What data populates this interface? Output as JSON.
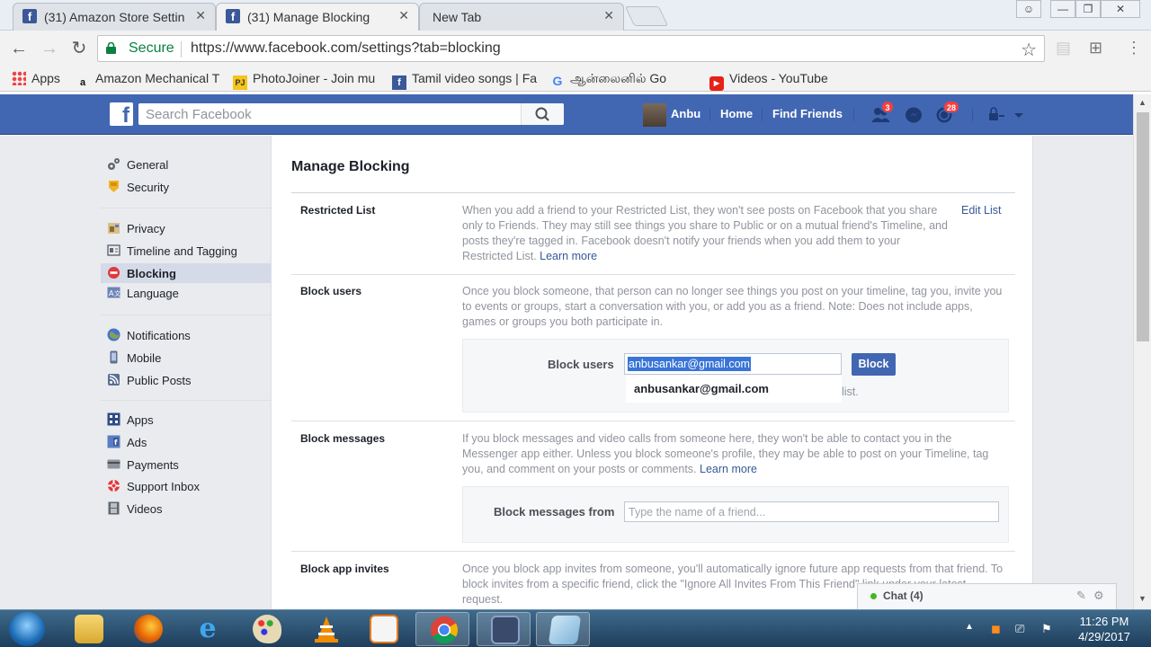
{
  "browser": {
    "tabs": [
      {
        "title": "(31) Amazon Store Settin"
      },
      {
        "title": "(31) Manage Blocking"
      },
      {
        "title": "New Tab"
      }
    ],
    "secure_label": "Secure",
    "url": "https://www.facebook.com/settings?tab=blocking",
    "bookmarks": [
      {
        "label": "Apps",
        "icon": "apps-grid-icon"
      },
      {
        "label": "Amazon Mechanical T",
        "icon": "amazon-icon"
      },
      {
        "label": "PhotoJoiner - Join mu",
        "icon": "photojoiner-icon"
      },
      {
        "label": "Tamil video songs | Fa",
        "icon": "facebook-icon"
      },
      {
        "label": "ஆன்லைனில் Go",
        "icon": "google-icon"
      },
      {
        "label": "Videos - YouTube",
        "icon": "youtube-icon"
      }
    ]
  },
  "fb": {
    "search_placeholder": "Search Facebook",
    "user_name": "Anbu",
    "home": "Home",
    "find_friends": "Find Friends",
    "friend_requests_count": "3",
    "notifications_count": "28",
    "brand_color": "#4267b2"
  },
  "sidebar": {
    "items": [
      {
        "label": "General",
        "icon": "gear-icon"
      },
      {
        "label": "Security",
        "icon": "badge-icon"
      },
      {
        "label": "Privacy",
        "icon": "lock-icon"
      },
      {
        "label": "Timeline and Tagging",
        "icon": "timeline-icon"
      },
      {
        "label": "Blocking",
        "icon": "block-icon"
      },
      {
        "label": "Language",
        "icon": "language-icon"
      },
      {
        "label": "Notifications",
        "icon": "globe-icon"
      },
      {
        "label": "Mobile",
        "icon": "mobile-icon"
      },
      {
        "label": "Public Posts",
        "icon": "rss-icon"
      },
      {
        "label": "Apps",
        "icon": "apps-icon"
      },
      {
        "label": "Ads",
        "icon": "ads-icon"
      },
      {
        "label": "Payments",
        "icon": "card-icon"
      },
      {
        "label": "Support Inbox",
        "icon": "lifebuoy-icon"
      },
      {
        "label": "Videos",
        "icon": "film-icon"
      }
    ]
  },
  "main": {
    "title": "Manage Blocking",
    "restricted": {
      "label": "Restricted List",
      "text": "When you add a friend to your Restricted List, they won't see posts on Facebook that you share only to Friends. They may still see things you share to Public or on a mutual friend's Timeline, and posts they're tagged in. Facebook doesn't notify your friends when you add them to your Restricted List.",
      "learn_more": "Learn more",
      "edit_link": "Edit List"
    },
    "block_users": {
      "label": "Block users",
      "text": "Once you block someone, that person can no longer see things you post on your timeline, tag you, invite you to events or groups, start a conversation with you, or add you as a friend. Note: Does not include apps, games or groups you both participate in.",
      "field_label": "Block users",
      "input_value": "anbusankar@gmail.com",
      "button": "Block",
      "suggestion": "anbusankar@gmail.com",
      "partial_text": "list."
    },
    "block_messages": {
      "label": "Block messages",
      "text": "If you block messages and video calls from someone here, they won't be able to contact you in the Messenger app either. Unless you block someone's profile, they may be able to post on your Timeline, tag you, and comment on your posts or comments.",
      "learn_more": "Learn more",
      "field_label": "Block messages from",
      "placeholder": "Type the name of a friend..."
    },
    "block_app_invites": {
      "label": "Block app invites",
      "text": "Once you block app invites from someone, you'll automatically ignore future app requests from that friend. To block invites from a specific friend, click the \"Ignore All Invites From This Friend\" link under your latest request."
    }
  },
  "chat": {
    "label": "Chat (4)"
  },
  "taskbar": {
    "time": "11:26 PM",
    "date": "4/29/2017"
  }
}
